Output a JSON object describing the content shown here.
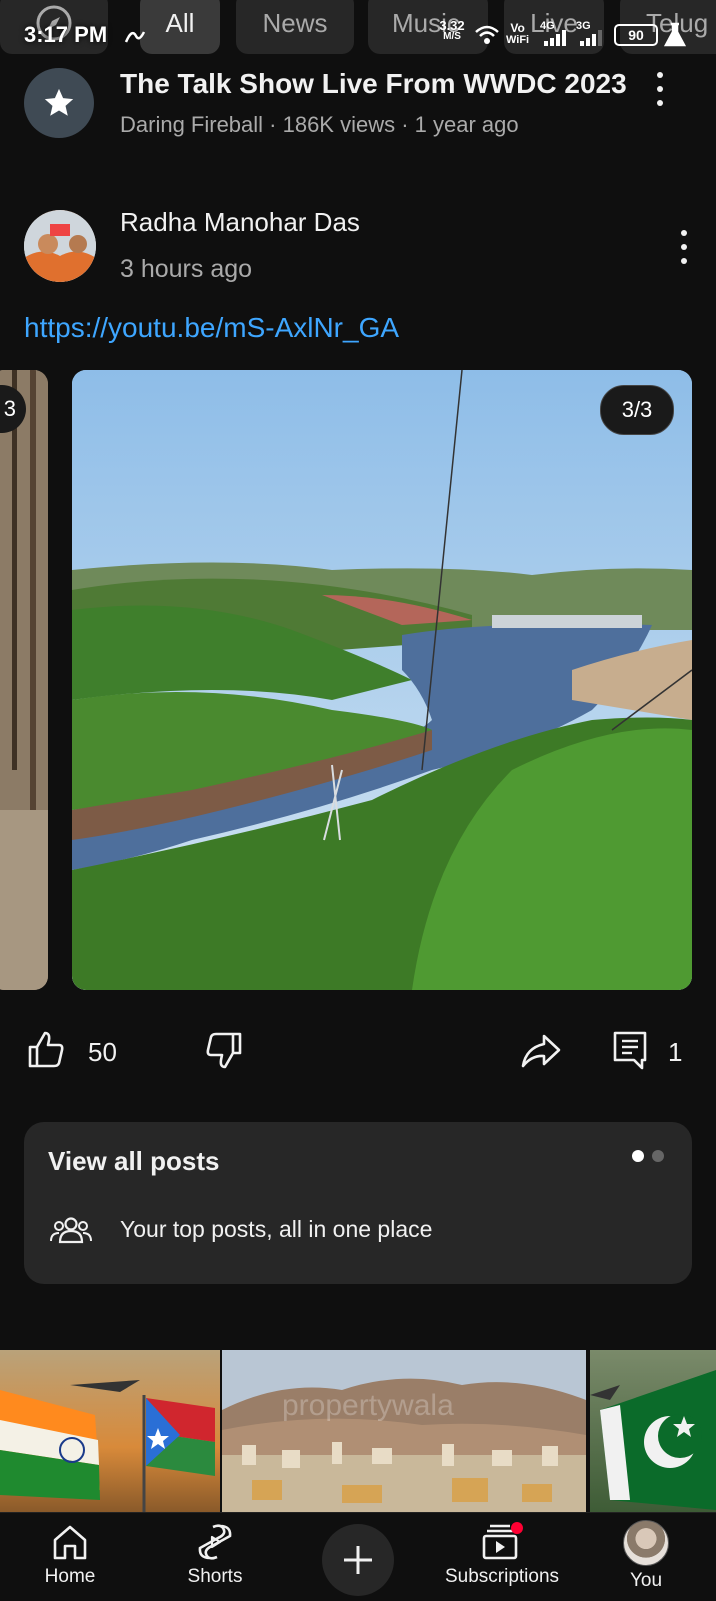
{
  "status_bar": {
    "time": "3:17 PM",
    "speed_value": "3.32",
    "speed_unit": "M/S",
    "vowifi_top": "Vo",
    "vowifi_bottom": "WiFi",
    "net1": "4G",
    "net2": "3G",
    "battery": "90"
  },
  "chips": [
    "All",
    "News",
    "Music",
    "Live",
    "Telug"
  ],
  "top_video": {
    "title": "The Talk Show Live From WWDC 2023",
    "meta": "Daring Fireball · 186K views · 1 year ago"
  },
  "post": {
    "author": "Radha Manohar Das",
    "time": "3 hours ago",
    "link": "https://youtu.be/mS-AxlNr_GA",
    "image_counter": "3/3",
    "prev_counter": "3",
    "likes": "50",
    "comments": "1"
  },
  "view_all_card": {
    "title": "View all posts",
    "subtitle": "Your top posts, all in one place"
  },
  "thumbnail": {
    "watermark": "propertywala"
  },
  "nav": {
    "home": "Home",
    "shorts": "Shorts",
    "subscriptions": "Subscriptions",
    "you": "You"
  },
  "colors": {
    "background": "#0f0f0f",
    "link": "#3ea6ff",
    "card": "#272727",
    "notification": "#ff0033"
  }
}
